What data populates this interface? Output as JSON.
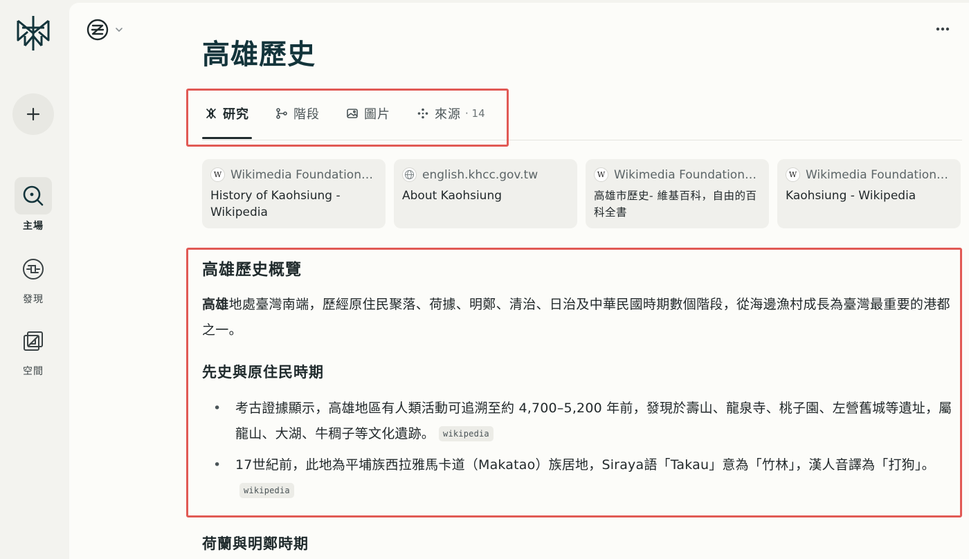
{
  "rail": {
    "new_label": "+",
    "items": [
      {
        "label": "主場",
        "icon": "search-icon"
      },
      {
        "label": "發現",
        "icon": "discover-icon"
      },
      {
        "label": "空間",
        "icon": "spaces-icon"
      }
    ]
  },
  "page": {
    "title": "高雄歷史"
  },
  "tabs": [
    {
      "label": "研究",
      "icon": "research-icon"
    },
    {
      "label": "階段",
      "icon": "steps-icon"
    },
    {
      "label": "圖片",
      "icon": "image-icon"
    },
    {
      "label": "來源",
      "icon": "sources-icon",
      "count": "· 14"
    }
  ],
  "sources": [
    {
      "site": "Wikimedia Foundation,...",
      "badge": "W",
      "title": "History of Kaohsiung - Wikipedia"
    },
    {
      "site": "english.khcc.gov.tw",
      "badge": "globe",
      "title": "About Kaohsiung"
    },
    {
      "site": "Wikimedia Foundation,...",
      "badge": "W",
      "title": "高雄市歷史- 維基百科，自由的百科全書"
    },
    {
      "site": "Wikimedia Foundation,...",
      "badge": "W",
      "title": "Kaohsiung - Wikipedia"
    }
  ],
  "answer": {
    "heading": "高雄歷史概覽",
    "intro_bold": "高雄",
    "intro_rest": "地處臺灣南端，歷經原住民聚落、荷據、明鄭、清治、日治及中華民國時期數個階段，從海邊漁村成長為臺灣最重要的港都之一。",
    "section1": "先史與原住民時期",
    "bullets": [
      {
        "text": "考古證據顯示，高雄地區有人類活動可追溯至約 4,700–5,200 年前，發現於壽山、龍泉寺、桃子園、左營舊城等遺址，屬龍山、大湖、牛稠子等文化遺跡。",
        "cite": "wikipedia"
      },
      {
        "text": "17世紀前，此地為平埔族西拉雅馬卡道（Makatao）族居地，Siraya語「Takau」意為「竹林」，漢人音譯為「打狗」。",
        "cite": "wikipedia"
      }
    ],
    "section2": "荷蘭與明鄭時期"
  },
  "colors": {
    "highlight": "#e15a55",
    "accent": "#13343b"
  }
}
